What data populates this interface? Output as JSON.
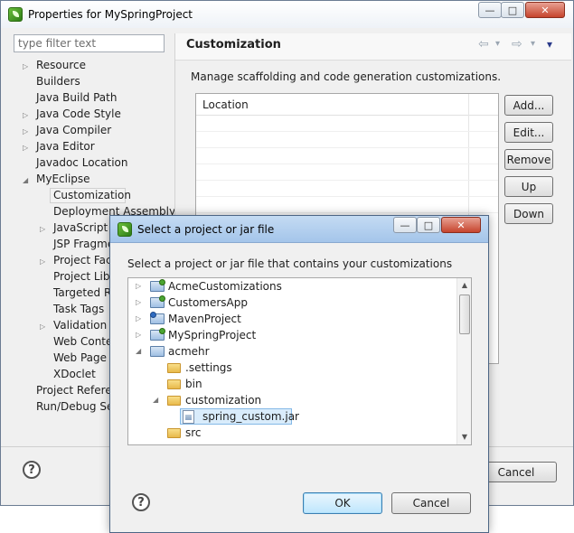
{
  "main_window": {
    "title": "Properties for MySpringProject",
    "controls": {
      "minimize": "—",
      "maximize": "□",
      "close": "✕"
    }
  },
  "filter": {
    "placeholder": "type filter text"
  },
  "property_tree": [
    {
      "label": "Resource",
      "expander": "▷"
    },
    {
      "label": "Builders",
      "expander": ""
    },
    {
      "label": "Java Build Path",
      "expander": ""
    },
    {
      "label": "Java Code Style",
      "expander": "▷"
    },
    {
      "label": "Java Compiler",
      "expander": "▷"
    },
    {
      "label": "Java Editor",
      "expander": "▷"
    },
    {
      "label": "Javadoc Location",
      "expander": ""
    },
    {
      "label": "MyEclipse",
      "expander": "◢"
    },
    {
      "label": "Customization",
      "expander": ""
    },
    {
      "label": "Deployment Assembly",
      "expander": ""
    },
    {
      "label": "JavaScript",
      "expander": "▷"
    },
    {
      "label": "JSP Fragmen",
      "expander": ""
    },
    {
      "label": "Project Face",
      "expander": "▷"
    },
    {
      "label": "Project Libra",
      "expander": ""
    },
    {
      "label": "Targeted Ru",
      "expander": ""
    },
    {
      "label": "Task Tags",
      "expander": ""
    },
    {
      "label": "Validation",
      "expander": "▷"
    },
    {
      "label": "Web Conten",
      "expander": ""
    },
    {
      "label": "Web Page Ed",
      "expander": ""
    },
    {
      "label": "XDoclet",
      "expander": ""
    },
    {
      "label": "Project Referen",
      "expander": ""
    },
    {
      "label": "Run/Debug Sett",
      "expander": ""
    }
  ],
  "section": {
    "title": "Customization",
    "description": "Manage scaffolding and code generation customizations.",
    "nav": {
      "back": "⇦",
      "forward": "⇨",
      "menu": "▾"
    }
  },
  "location_table": {
    "header": "Location"
  },
  "side_buttons": {
    "add": "Add...",
    "edit": "Edit...",
    "remove": "Remove",
    "up": "Up",
    "down": "Down"
  },
  "main_footer": {
    "help": "?",
    "cancel": "Cancel"
  },
  "dialog": {
    "title": "Select a project or jar file",
    "controls": {
      "minimize": "—",
      "maximize": "□",
      "close": "✕"
    },
    "prompt": "Select a project or jar file that contains your customizations",
    "tree": [
      {
        "label": "AcmeCustomizations",
        "expander": "▷",
        "icon": "project"
      },
      {
        "label": "CustomersApp",
        "expander": "▷",
        "icon": "project"
      },
      {
        "label": "MavenProject",
        "expander": "▷",
        "icon": "project"
      },
      {
        "label": "MySpringProject",
        "expander": "▷",
        "icon": "project"
      },
      {
        "label": "acmehr",
        "expander": "◢",
        "icon": "project"
      },
      {
        "label": ".settings",
        "expander": "",
        "icon": "folder"
      },
      {
        "label": "bin",
        "expander": "",
        "icon": "folder"
      },
      {
        "label": "customization",
        "expander": "◢",
        "icon": "folder"
      },
      {
        "label": "spring_custom.jar",
        "expander": "",
        "icon": "jar"
      },
      {
        "label": "src",
        "expander": "",
        "icon": "folder"
      }
    ],
    "help": "?",
    "ok": "OK",
    "cancel": "Cancel"
  }
}
